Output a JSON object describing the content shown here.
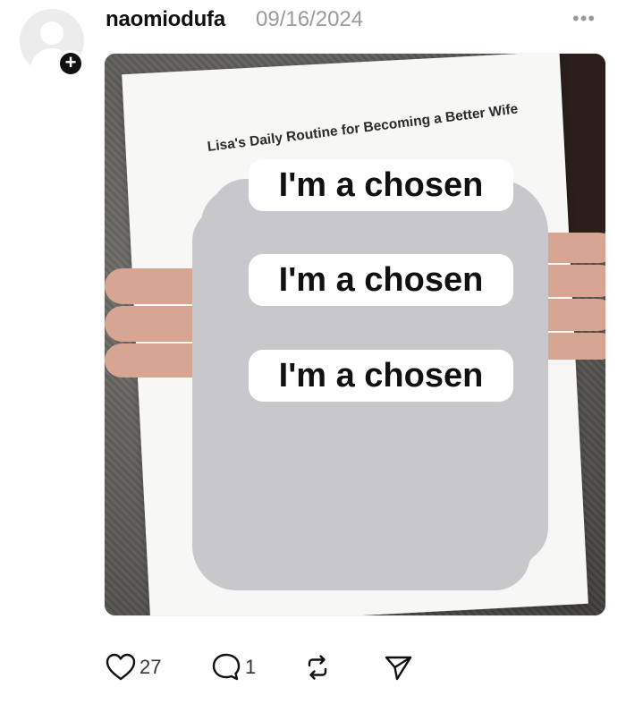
{
  "post": {
    "username": "naomiodufa",
    "date": "09/16/2024",
    "more_label": "•••"
  },
  "avatar": {
    "badge": "+"
  },
  "image": {
    "paper_title": "Lisa's Daily Routine for Becoming a Better Wife",
    "lines": [
      "I'm a chosen",
      "I'm a chosen",
      "I'm a chosen"
    ]
  },
  "actions": {
    "likes": "27",
    "replies": "1"
  },
  "icons": {
    "like": "heart-icon",
    "reply": "comment-icon",
    "repost": "repost-icon",
    "share": "send-icon"
  }
}
